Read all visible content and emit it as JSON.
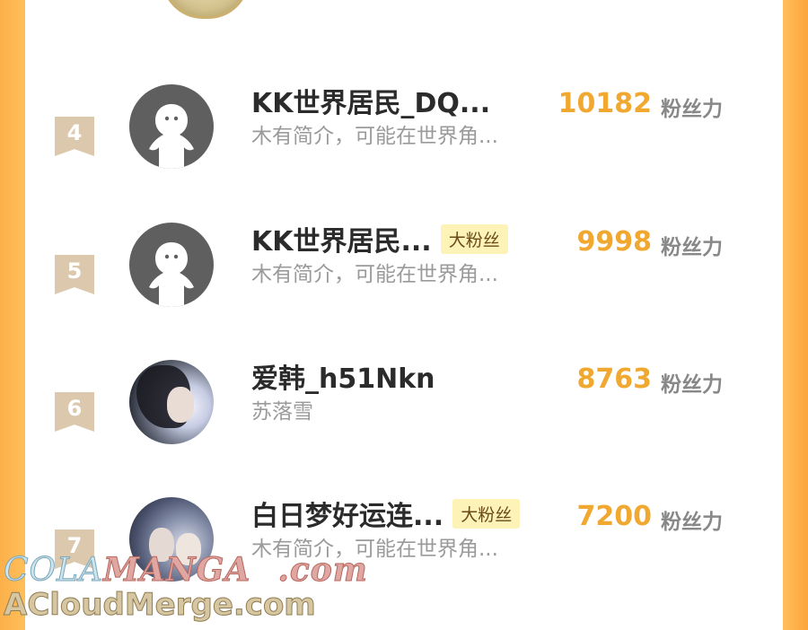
{
  "ranking": {
    "rows": [
      {
        "rank": "4",
        "name": "KK世界居民_DQ...",
        "badge": "",
        "intro": "木有简介，可能在世界角...",
        "score": "10182",
        "unit": "粉丝力",
        "avatar": "default-avatar-icon"
      },
      {
        "rank": "5",
        "name": "KK世界居民...",
        "badge": "大粉丝",
        "intro": "木有简介，可能在世界角...",
        "score": "9998",
        "unit": "粉丝力",
        "avatar": "default-avatar-icon"
      },
      {
        "rank": "6",
        "name": "爱韩_h51Nkn",
        "badge": "",
        "intro": "苏落雪",
        "score": "8763",
        "unit": "粉丝力",
        "avatar": "photo-avatar"
      },
      {
        "rank": "7",
        "name": "白日梦好运连...",
        "badge": "大粉丝",
        "intro": "木有简介，可能在世界角...",
        "score": "7200",
        "unit": "粉丝力",
        "avatar": "photo-avatar"
      }
    ]
  },
  "watermark": {
    "line1_part1": "COLA",
    "line1_part2": "MANGA",
    "line1_part3": ".com",
    "line2": "ACloudMerge.com"
  },
  "colors": {
    "background": "#ffbe5a",
    "score": "#f0a830",
    "badge_bg": "#fdf3b7",
    "rank_badge": "#dcc8ad"
  }
}
